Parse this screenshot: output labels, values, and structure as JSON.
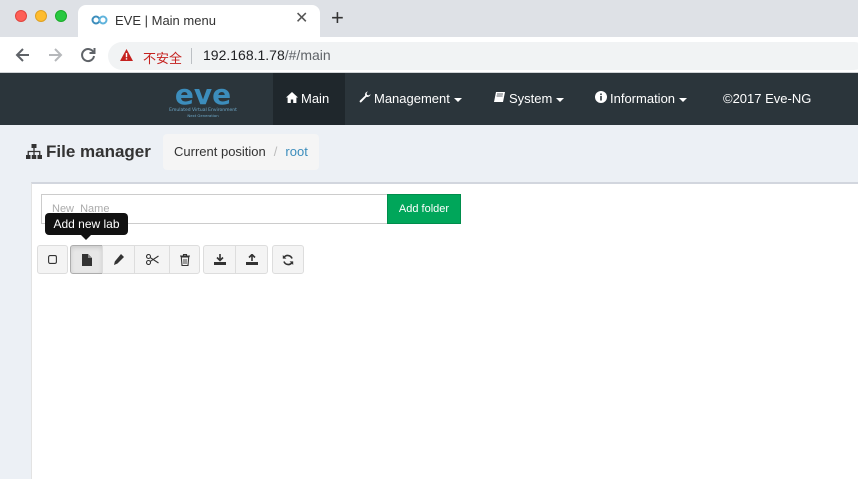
{
  "browser": {
    "tab_title": "EVE | Main menu",
    "tab_close": "✕",
    "new_tab": "+",
    "security_label": "不安全",
    "url_host": "192.168.1.78",
    "url_path": "/#/main"
  },
  "navbar": {
    "logo_text": "eve",
    "logo_subtitle": "Emulated Virtual Environment",
    "logo_subtitle2": "Next Generation",
    "items": [
      {
        "label": "Main",
        "icon": "home-icon"
      },
      {
        "label": "Management",
        "icon": "wrench-icon"
      },
      {
        "label": "System",
        "icon": "book-icon"
      },
      {
        "label": "Information",
        "icon": "info-circle-icon"
      },
      {
        "label": "©2017 Eve-NG"
      }
    ]
  },
  "page": {
    "title": "File manager",
    "breadcrumb_label": "Current position",
    "breadcrumb_separator": "/",
    "breadcrumb_root": "root"
  },
  "folder_form": {
    "placeholder": "New  Name",
    "add_folder_label": "Add folder"
  },
  "toolbar": {
    "tooltip": "Add new lab",
    "buttons": [
      "select-all",
      "add-new-lab",
      "rename",
      "move",
      "delete",
      "import",
      "export",
      "refresh"
    ]
  },
  "colors": {
    "navbar_bg": "#2b353b",
    "accent_link": "#3c8dbc",
    "add_folder_green": "#00a65a",
    "page_bg": "#ecf0f5"
  }
}
